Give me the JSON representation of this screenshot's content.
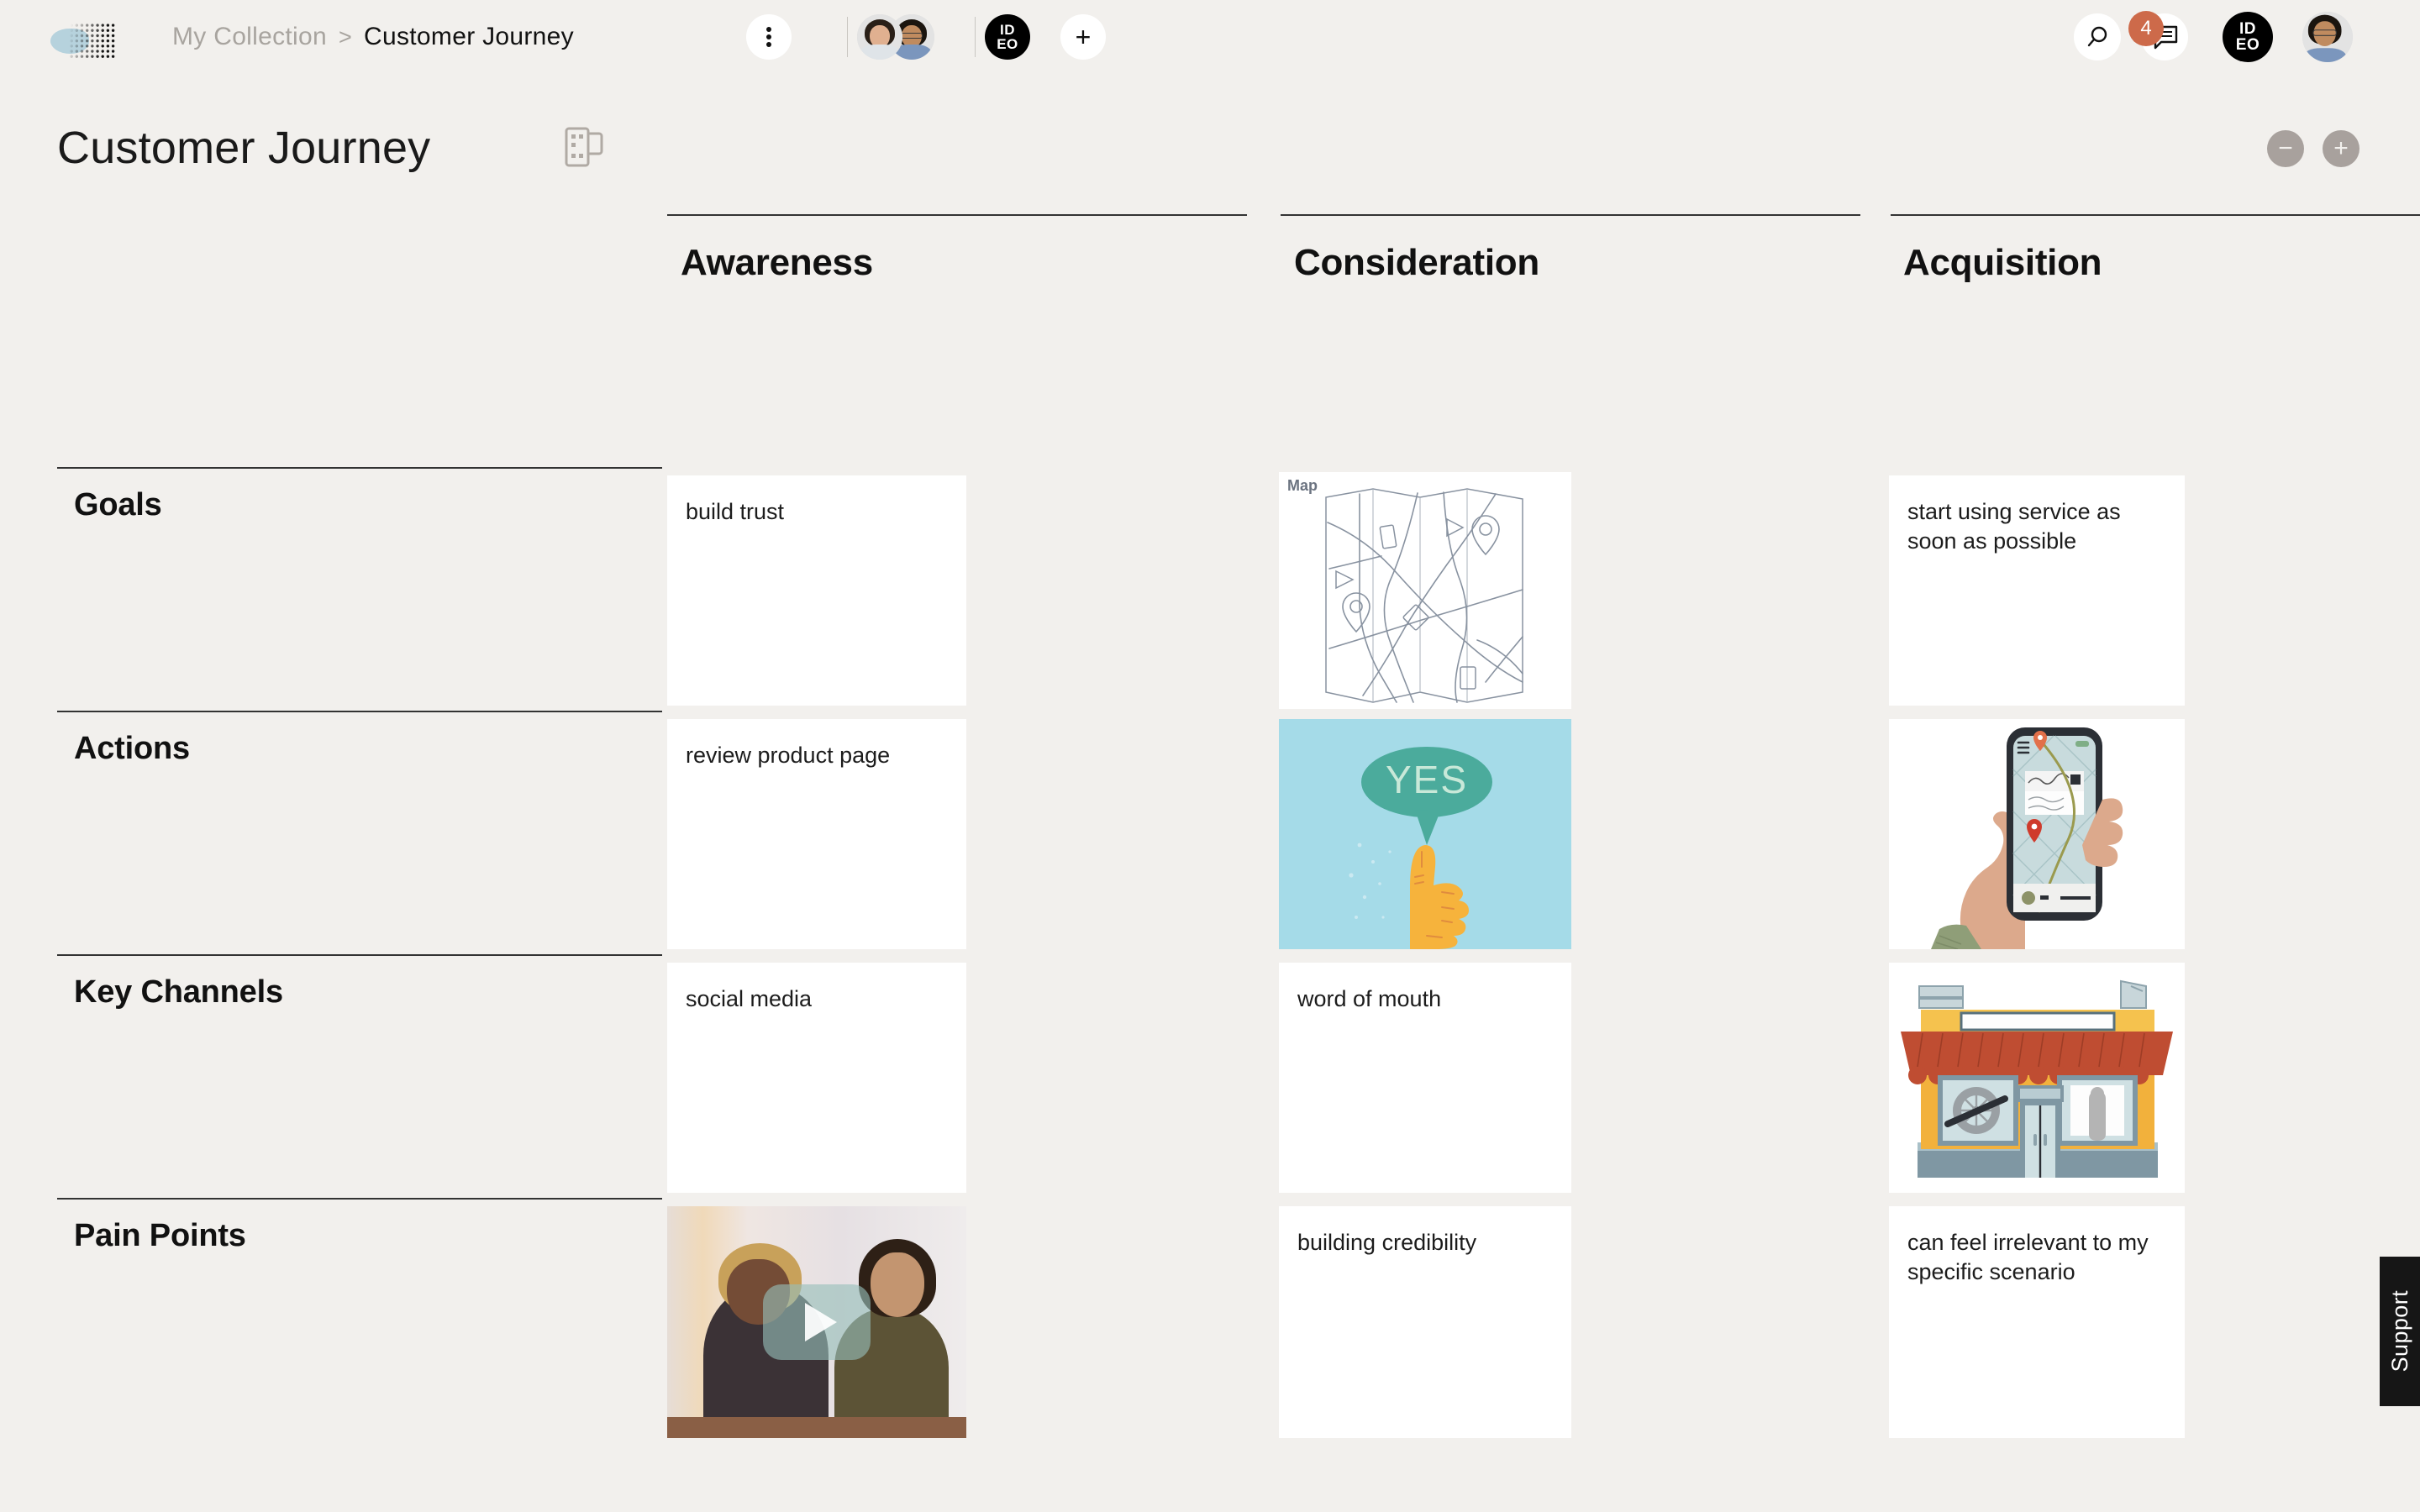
{
  "app": {
    "logo_name": "ideo-halftone-logo",
    "brand_mark": "IDEO"
  },
  "topbar": {
    "breadcrumb": {
      "collection": "My Collection",
      "separator": ">",
      "current": "Customer Journey"
    },
    "kebab_icon": "more-options-icon",
    "add_label": "+",
    "collaborators": [
      "collaborator-1",
      "collaborator-2"
    ],
    "org_badge_top": "ID",
    "org_badge_bottom": "EO",
    "search_icon": "search-icon",
    "comments_icon": "comment-icon",
    "comments_count": "4",
    "user_avatar": "current-user-avatar"
  },
  "page": {
    "title": "Customer Journey",
    "template_icon": "template-grid-icon",
    "zoom_out_label": "−",
    "zoom_in_label": "+"
  },
  "board": {
    "columns": [
      {
        "label": "Awareness"
      },
      {
        "label": "Consideration"
      },
      {
        "label": "Acquisition"
      }
    ],
    "rows": [
      {
        "label": "Goals"
      },
      {
        "label": "Actions"
      },
      {
        "label": "Key Channels"
      },
      {
        "label": "Pain Points"
      }
    ],
    "cells": [
      {
        "row": "Goals",
        "column": "Awareness",
        "type": "text",
        "text": "build trust"
      },
      {
        "row": "Goals",
        "column": "Consideration",
        "type": "image",
        "media": "folded-paper-map-illustration",
        "caption": "Map"
      },
      {
        "row": "Goals",
        "column": "Acquisition",
        "type": "text",
        "text": "start using service as soon as possible"
      },
      {
        "row": "Actions",
        "column": "Awareness",
        "type": "text",
        "text": "review product page"
      },
      {
        "row": "Actions",
        "column": "Consideration",
        "type": "image",
        "media": "thumbs-up-yes-illustration",
        "caption": "YES"
      },
      {
        "row": "Actions",
        "column": "Acquisition",
        "type": "image",
        "media": "hand-holding-phone-map-illustration",
        "caption": ""
      },
      {
        "row": "Key Channels",
        "column": "Awareness",
        "type": "text",
        "text": "social media"
      },
      {
        "row": "Key Channels",
        "column": "Consideration",
        "type": "text",
        "text": "word of mouth"
      },
      {
        "row": "Key Channels",
        "column": "Acquisition",
        "type": "image",
        "media": "storefront-illustration",
        "caption": ""
      },
      {
        "row": "Pain Points",
        "column": "Awareness",
        "type": "video",
        "media": "two-women-meeting-video-thumbnail",
        "caption": ""
      },
      {
        "row": "Pain Points",
        "column": "Consideration",
        "type": "text",
        "text": "building credibility"
      },
      {
        "row": "Pain Points",
        "column": "Acquisition",
        "type": "text",
        "text": "can feel irrelevant to my specific scenario"
      }
    ]
  },
  "support": {
    "label": "Support"
  },
  "colors": {
    "background": "#f2f0ed",
    "card": "#ffffff",
    "accent_badge": "#cd6a4a",
    "rule": "#333333",
    "muted_text": "#a8a49f",
    "zoom_button": "#a8a19d",
    "yes_panel": "#a5dbe8",
    "support_tab": "#161616"
  }
}
